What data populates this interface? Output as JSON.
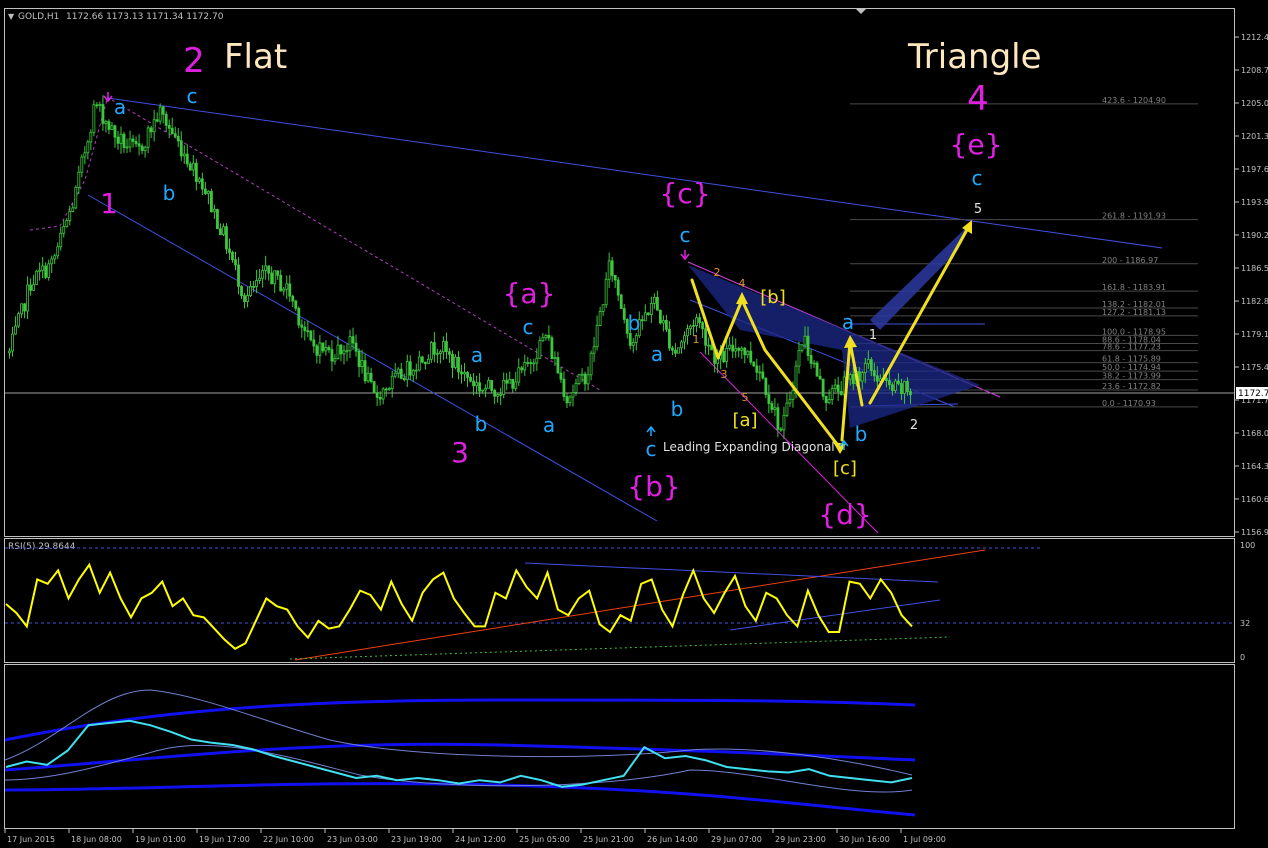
{
  "header": {
    "symbol": "GOLD,H1",
    "ohlc": "1172.66 1173.13 1171.34 1172.70",
    "rsi_label": "RSI(5) 29.8644",
    "current_price_tag": "1172.7"
  },
  "colors": {
    "background": "#000000",
    "candles": "#3ec63e",
    "wave_magenta": "#e020e0",
    "wave_cyan": "#20a8ff",
    "wave_yellow": "#f0e020",
    "channel_blue": "#4050e0",
    "rsi_line": "#ffff00",
    "trend_orange": "#f04010",
    "indicator_cyan": "#40e0f0",
    "band_blue": "#1010f0",
    "grid_text": "#c0c0c0",
    "fib_text": "#808080"
  },
  "price_axis": [
    "1212.4",
    "1208.7",
    "1205.0",
    "1201.3",
    "1197.6",
    "1193.9",
    "1190.2",
    "1186.5",
    "1182.8",
    "1179.1",
    "1175.4",
    "1171.7",
    "1168.0",
    "1164.3",
    "1160.6",
    "1156.9"
  ],
  "rsi_axis": [
    "100",
    "32",
    "0"
  ],
  "time_axis": [
    "17 Jun 2015",
    "18 Jun 08:00",
    "19 Jun 01:00",
    "19 Jun 17:00",
    "22 Jun 10:00",
    "23 Jun 03:00",
    "23 Jun 19:00",
    "24 Jun 12:00",
    "25 Jun 05:00",
    "25 Jun 21:00",
    "26 Jun 14:00",
    "29 Jun 07:00",
    "29 Jun 23:00",
    "30 Jun 16:00",
    "1 Jul 09:00"
  ],
  "fib_levels": [
    {
      "ratio": "423.6",
      "price": "1204.90"
    },
    {
      "ratio": "261.8",
      "price": "1191.93"
    },
    {
      "ratio": "200",
      "price": "1186.97"
    },
    {
      "ratio": "161.8",
      "price": "1183.91"
    },
    {
      "ratio": "138.2",
      "price": "1182.01"
    },
    {
      "ratio": "127.2",
      "price": "1181.13"
    },
    {
      "ratio": "100.0",
      "price": "1178.95"
    },
    {
      "ratio": "88.6",
      "price": "1178.04"
    },
    {
      "ratio": "78.6",
      "price": "1177.23"
    },
    {
      "ratio": "61.8",
      "price": "1175.89"
    },
    {
      "ratio": "50.0",
      "price": "1174.94"
    },
    {
      "ratio": "38.2",
      "price": "1173.99"
    },
    {
      "ratio": "23.6",
      "price": "1172.82"
    },
    {
      "ratio": "0.0",
      "price": "1170.93"
    }
  ],
  "annotations": {
    "flat_title": "Flat",
    "triangle_title": "Triangle",
    "diagonal_label": "Leading Expanding Diagonal"
  },
  "wave_labels": [
    {
      "t": "2",
      "c": "magenta",
      "s": 34
    },
    {
      "t": "1",
      "c": "magenta",
      "s": 28
    },
    {
      "t": "3",
      "c": "magenta",
      "s": 28
    },
    {
      "t": "4",
      "c": "magenta",
      "s": 34
    },
    {
      "t": "{a}",
      "c": "magenta",
      "s": 28
    },
    {
      "t": "{b}",
      "c": "magenta",
      "s": 28
    },
    {
      "t": "{c}",
      "c": "magenta",
      "s": 28
    },
    {
      "t": "{d}",
      "c": "magenta",
      "s": 28
    },
    {
      "t": "{e}",
      "c": "magenta",
      "s": 28
    },
    {
      "t": "a",
      "c": "cyan",
      "s": 20
    },
    {
      "t": "c",
      "c": "cyan",
      "s": 20
    },
    {
      "t": "b",
      "c": "cyan",
      "s": 20
    },
    {
      "t": "a",
      "c": "cyan",
      "s": 20
    },
    {
      "t": "c",
      "c": "cyan",
      "s": 20
    },
    {
      "t": "b",
      "c": "cyan",
      "s": 20
    },
    {
      "t": "a",
      "c": "cyan",
      "s": 20
    },
    {
      "t": "b",
      "c": "cyan",
      "s": 20
    },
    {
      "t": "a",
      "c": "cyan",
      "s": 20
    },
    {
      "t": "b",
      "c": "cyan",
      "s": 20
    },
    {
      "t": "c",
      "c": "cyan",
      "s": 20
    },
    {
      "t": "c",
      "c": "cyan",
      "s": 20
    },
    {
      "t": "a",
      "c": "cyan",
      "s": 20
    },
    {
      "t": "b",
      "c": "cyan",
      "s": 20
    },
    {
      "t": "c",
      "c": "cyan",
      "s": 20
    },
    {
      "t": "[a]",
      "c": "yellow",
      "s": 18
    },
    {
      "t": "[b]",
      "c": "yellow",
      "s": 18
    },
    {
      "t": "[c]",
      "c": "yellow",
      "s": 18
    },
    {
      "t": "1",
      "c": "orange",
      "s": 11
    },
    {
      "t": "2",
      "c": "orange",
      "s": 11
    },
    {
      "t": "3",
      "c": "orange",
      "s": 11
    },
    {
      "t": "4",
      "c": "orange",
      "s": 11
    },
    {
      "t": "5",
      "c": "orange",
      "s": 11
    },
    {
      "t": "1",
      "c": "white",
      "s": 13
    },
    {
      "t": "2",
      "c": "white",
      "s": 13
    },
    {
      "t": "5",
      "c": "white",
      "s": 13
    }
  ],
  "chart_data": {
    "type": "candlestick",
    "symbol": "GOLD",
    "timeframe": "H1",
    "ylim": [
      1156.9,
      1212.4
    ],
    "last_price": 1172.7,
    "path": [
      {
        "t": "17 Jun 2015",
        "p": 1177
      },
      {
        "t": "17 Jun 12:00",
        "p": 1185
      },
      {
        "t": "17 Jun 18:00",
        "p": 1187
      },
      {
        "t": "18 Jun 02:00",
        "p": 1194
      },
      {
        "t": "18 Jun 08:00",
        "p": 1205
      },
      {
        "t": "18 Jun 16:00",
        "p": 1201
      },
      {
        "t": "19 Jun 01:00",
        "p": 1199.5
      },
      {
        "t": "19 Jun 09:00",
        "p": 1204
      },
      {
        "t": "19 Jun 17:00",
        "p": 1200
      },
      {
        "t": "20 Jun 00:00",
        "p": 1196
      },
      {
        "t": "22 Jun 04:00",
        "p": 1190
      },
      {
        "t": "22 Jun 10:00",
        "p": 1183
      },
      {
        "t": "22 Jun 18:00",
        "p": 1186
      },
      {
        "t": "23 Jun 03:00",
        "p": 1184
      },
      {
        "t": "23 Jun 12:00",
        "p": 1178
      },
      {
        "t": "23 Jun 19:00",
        "p": 1177
      },
      {
        "t": "24 Jun 04:00",
        "p": 1178
      },
      {
        "t": "24 Jun 08:00",
        "p": 1172
      },
      {
        "t": "24 Jun 12:00",
        "p": 1174
      },
      {
        "t": "24 Jun 20:00",
        "p": 1176
      },
      {
        "t": "25 Jun 02:00",
        "p": 1178
      },
      {
        "t": "25 Jun 05:00",
        "p": 1175
      },
      {
        "t": "25 Jun 12:00",
        "p": 1173
      },
      {
        "t": "25 Jun 21:00",
        "p": 1173
      },
      {
        "t": "26 Jun 04:00",
        "p": 1175
      },
      {
        "t": "26 Jun 07:00",
        "p": 1179
      },
      {
        "t": "26 Jun 09:00",
        "p": 1172
      },
      {
        "t": "26 Jun 14:00",
        "p": 1175
      },
      {
        "t": "28 Jun 23:00",
        "p": 1187
      },
      {
        "t": "29 Jun 02:00",
        "p": 1178
      },
      {
        "t": "29 Jun 04:00",
        "p": 1183
      },
      {
        "t": "29 Jun 07:00",
        "p": 1177
      },
      {
        "t": "29 Jun 12:00",
        "p": 1181
      },
      {
        "t": "29 Jun 16:00",
        "p": 1176
      },
      {
        "t": "29 Jun 23:00",
        "p": 1178
      },
      {
        "t": "30 Jun 06:00",
        "p": 1175
      },
      {
        "t": "30 Jun 09:00",
        "p": 1168
      },
      {
        "t": "30 Jun 12:00",
        "p": 1179
      },
      {
        "t": "30 Jun 14:00",
        "p": 1172
      },
      {
        "t": "30 Jun 16:00",
        "p": 1173.5
      },
      {
        "t": "30 Jun 22:00",
        "p": 1175.5
      },
      {
        "t": "1 Jul 04:00",
        "p": 1173
      },
      {
        "t": "1 Jul 09:00",
        "p": 1172.7
      }
    ],
    "rsi": {
      "period": 5,
      "last": 29.8644,
      "levels": [
        100,
        32,
        0
      ],
      "values": [
        50,
        42,
        30,
        72,
        68,
        80,
        55,
        72,
        85,
        60,
        78,
        55,
        38,
        55,
        60,
        70,
        48,
        55,
        40,
        38,
        28,
        18,
        10,
        15,
        35,
        55,
        48,
        45,
        30,
        20,
        35,
        28,
        30,
        45,
        62,
        58,
        45,
        70,
        50,
        35,
        60,
        72,
        78,
        55,
        42,
        30,
        30,
        60,
        55,
        80,
        65,
        55,
        78,
        45,
        40,
        55,
        62,
        32,
        25,
        40,
        35,
        68,
        72,
        45,
        30,
        58,
        80,
        55,
        42,
        60,
        75,
        48,
        35,
        60,
        55,
        40,
        30,
        62,
        40,
        25,
        25,
        70,
        68,
        55,
        72,
        60,
        40,
        30
      ]
    },
    "lower_indicator": {
      "values": [
        30,
        35,
        32,
        45,
        68,
        70,
        72,
        68,
        62,
        55,
        52,
        50,
        46,
        40,
        35,
        30,
        25,
        20,
        22,
        18,
        20,
        18,
        15,
        18,
        16,
        22,
        18,
        12,
        14,
        18,
        22,
        48,
        38,
        40,
        36,
        30,
        28,
        26,
        25,
        28,
        22,
        20,
        18,
        16,
        20
      ]
    }
  }
}
